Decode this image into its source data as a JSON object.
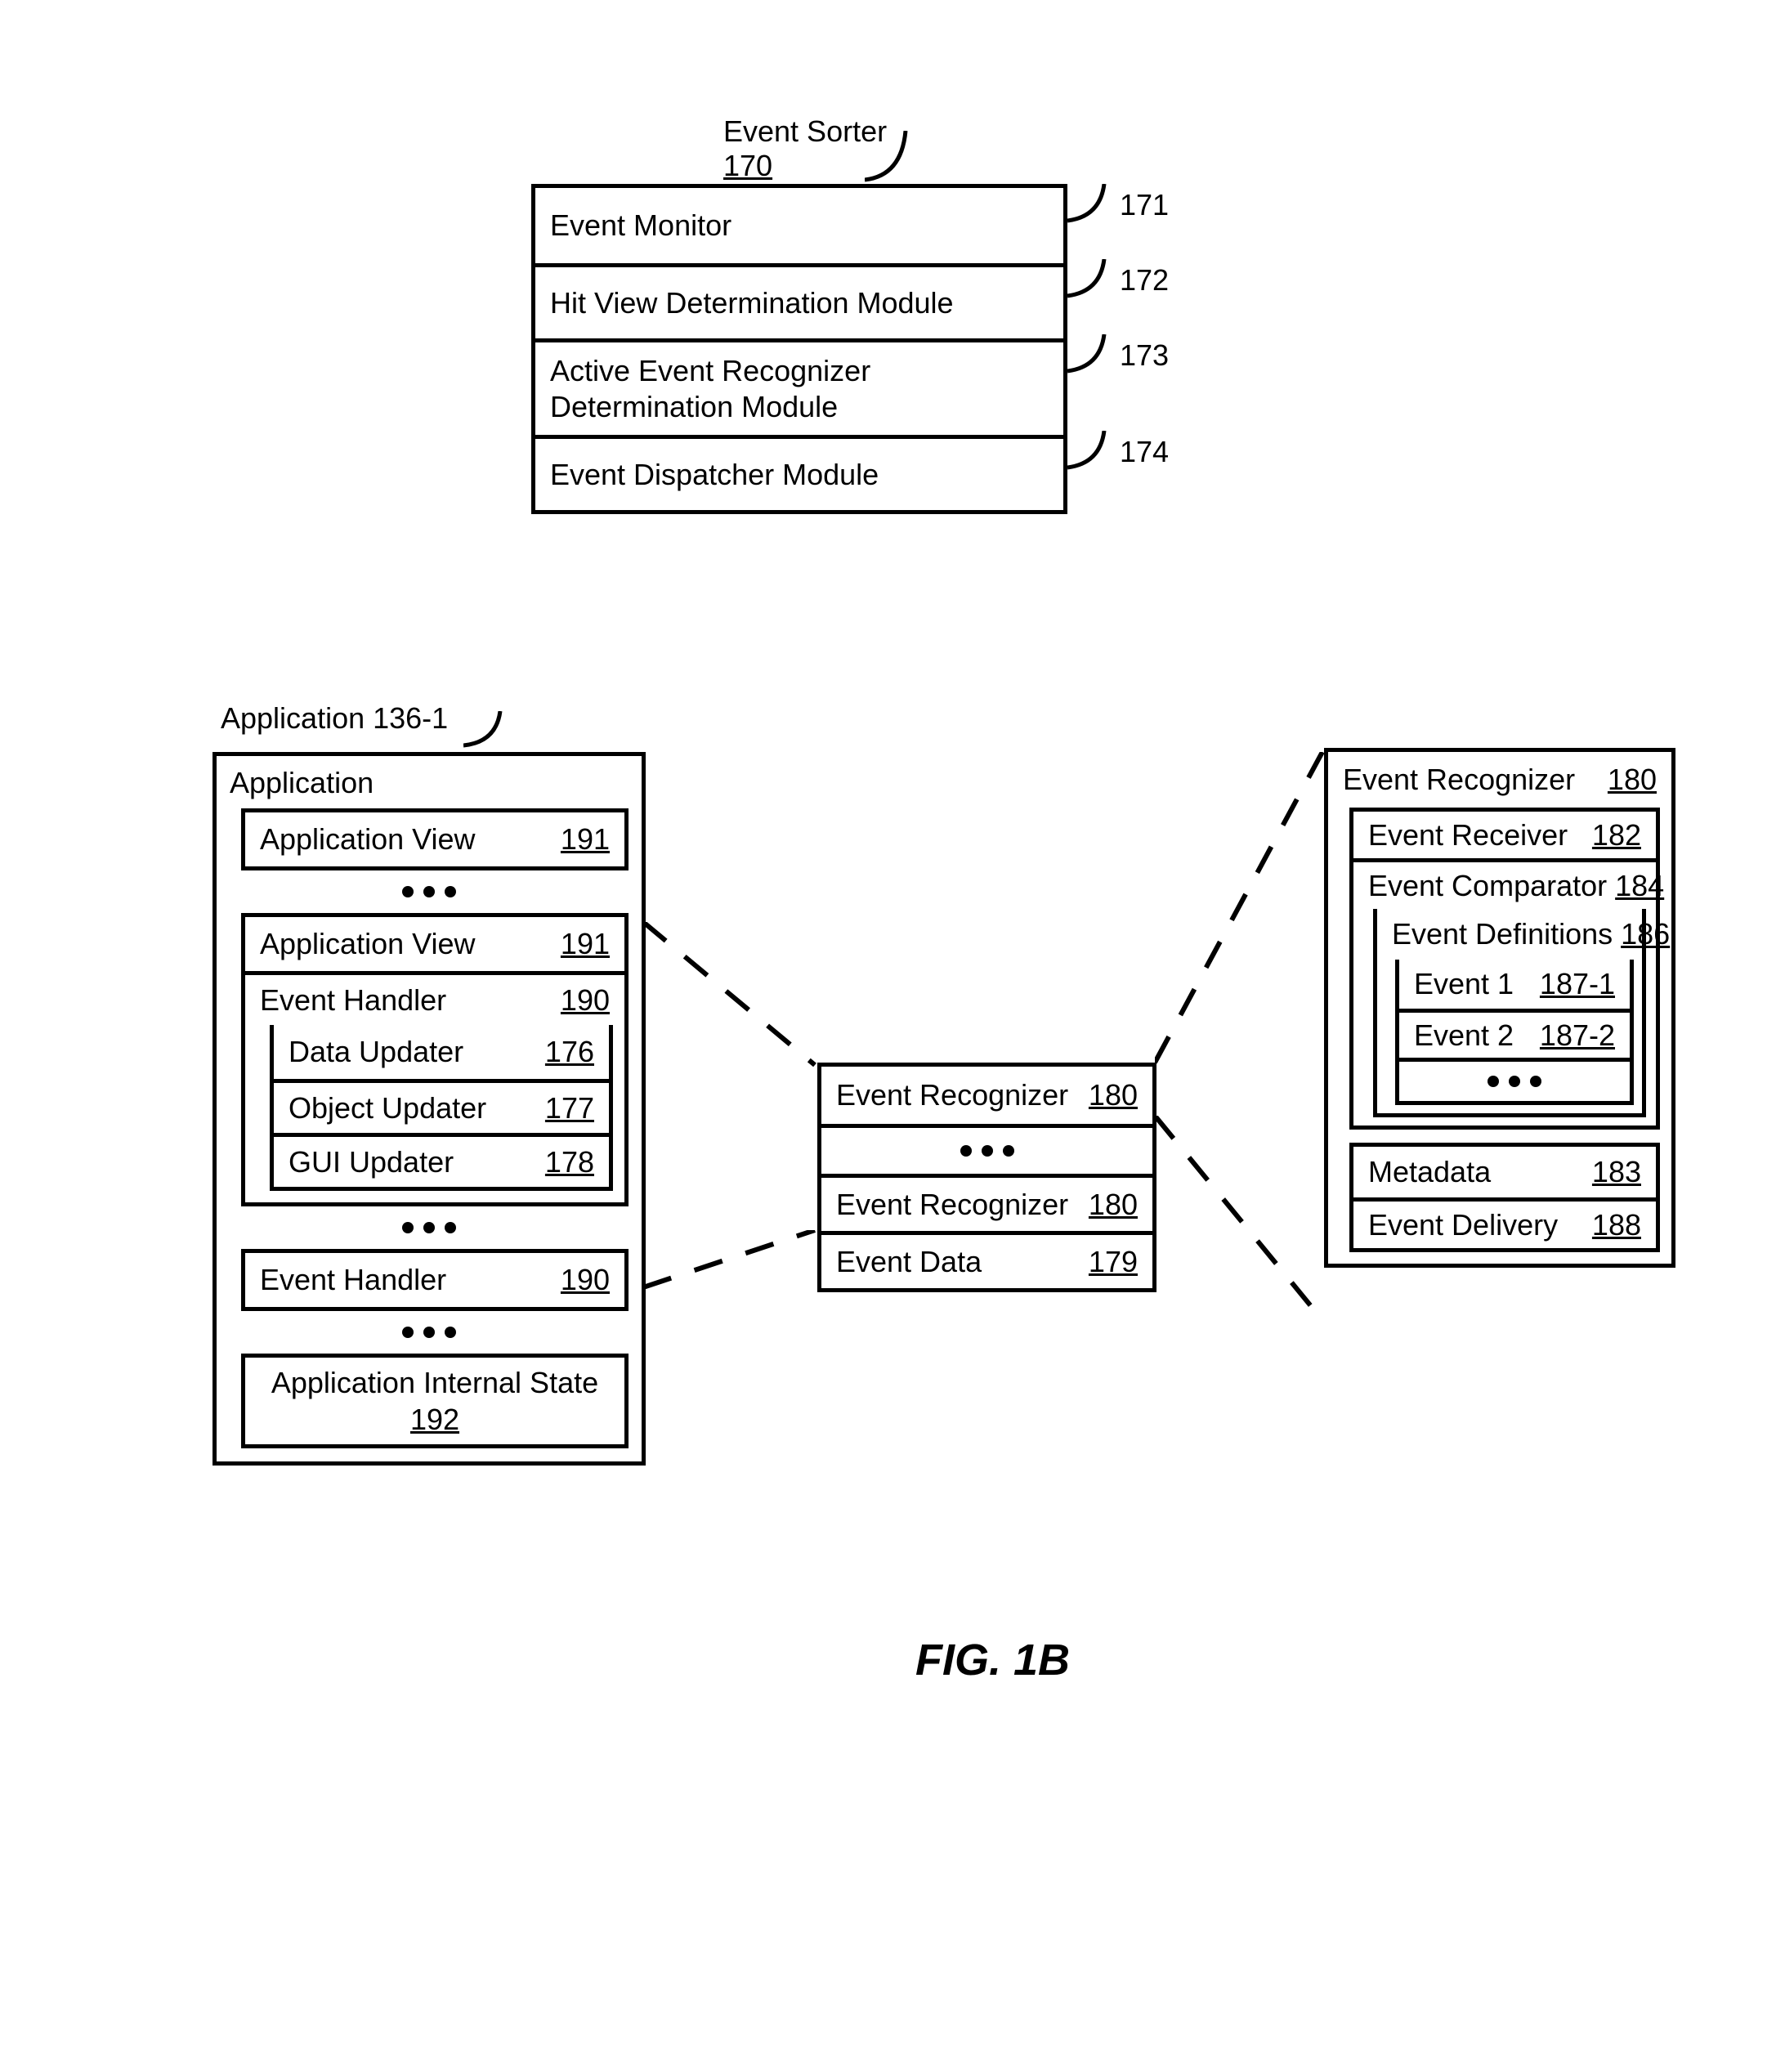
{
  "figureCaption": "FIG. 1B",
  "eventSorter": {
    "titleLabel": "Event Sorter",
    "titleNum": "170",
    "rows": [
      {
        "label": "Event Monitor",
        "num": "171"
      },
      {
        "label": "Hit View Determination Module",
        "num": "172"
      },
      {
        "label": "Active Event Recognizer Determination Module",
        "num": "173"
      },
      {
        "label": "Event Dispatcher Module",
        "num": "174"
      }
    ]
  },
  "application": {
    "titleLabel": "Application 136-1",
    "header": "Application",
    "appView1": {
      "label": "Application View",
      "num": "191"
    },
    "appView2": {
      "label": "Application View",
      "num": "191"
    },
    "eventHandler1": {
      "label": "Event Handler",
      "num": "190",
      "dataUpdater": {
        "label": "Data Updater",
        "num": "176"
      },
      "objectUpdater": {
        "label": "Object Updater",
        "num": "177"
      },
      "guiUpdater": {
        "label": "GUI Updater",
        "num": "178"
      }
    },
    "eventHandler2": {
      "label": "Event Handler",
      "num": "190"
    },
    "internalState": {
      "label": "Application Internal State",
      "num": "192"
    }
  },
  "recognizerList": {
    "row1": {
      "label": "Event Recognizer",
      "num": "180"
    },
    "row2": {
      "label": "Event Recognizer",
      "num": "180"
    },
    "eventData": {
      "label": "Event Data",
      "num": "179"
    }
  },
  "recognizerDetail": {
    "header": {
      "label": "Event Recognizer",
      "num": "180"
    },
    "receiver": {
      "label": "Event Receiver",
      "num": "182"
    },
    "comparator": {
      "label": "Event Comparator",
      "num": "184",
      "definitions": {
        "label": "Event Definitions",
        "num": "186",
        "event1": {
          "label": "Event 1",
          "num": "187-1"
        },
        "event2": {
          "label": "Event 2",
          "num": "187-2"
        }
      }
    },
    "metadata": {
      "label": "Metadata",
      "num": "183"
    },
    "delivery": {
      "label": "Event Delivery",
      "num": "188"
    }
  }
}
